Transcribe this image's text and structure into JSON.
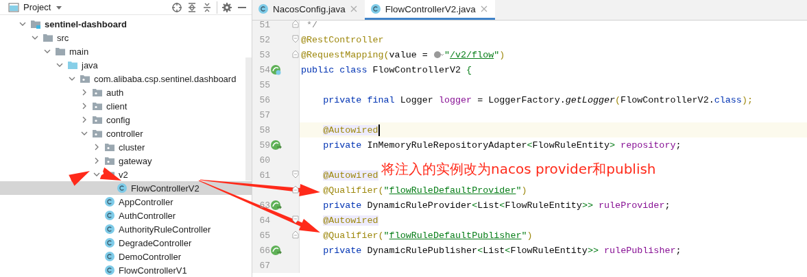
{
  "project_panel": {
    "title": "Project",
    "tree": [
      {
        "label": "sentinel-dashboard",
        "kind": "module",
        "expanded": true,
        "selected": false,
        "children": [
          {
            "label": "src",
            "kind": "folder",
            "expanded": true,
            "selected": false,
            "children": [
              {
                "label": "main",
                "kind": "folder",
                "expanded": true,
                "selected": false,
                "children": [
                  {
                    "label": "java",
                    "kind": "source",
                    "expanded": true,
                    "selected": false,
                    "children": [
                      {
                        "label": "com.alibaba.csp.sentinel.dashboard",
                        "kind": "package",
                        "expanded": true,
                        "selected": false,
                        "children": [
                          {
                            "label": "auth",
                            "kind": "package",
                            "expanded": false,
                            "selected": false
                          },
                          {
                            "label": "client",
                            "kind": "package",
                            "expanded": false,
                            "selected": false
                          },
                          {
                            "label": "config",
                            "kind": "package",
                            "expanded": false,
                            "selected": false
                          },
                          {
                            "label": "controller",
                            "kind": "package",
                            "expanded": true,
                            "selected": false,
                            "children": [
                              {
                                "label": "cluster",
                                "kind": "package",
                                "expanded": false,
                                "selected": false
                              },
                              {
                                "label": "gateway",
                                "kind": "package",
                                "expanded": false,
                                "selected": false
                              },
                              {
                                "label": "v2",
                                "kind": "package",
                                "expanded": true,
                                "selected": false,
                                "children": [
                                  {
                                    "label": "FlowControllerV2",
                                    "kind": "class",
                                    "selected": true
                                  }
                                ]
                              },
                              {
                                "label": "AppController",
                                "kind": "class",
                                "selected": false
                              },
                              {
                                "label": "AuthController",
                                "kind": "class",
                                "selected": false
                              },
                              {
                                "label": "AuthorityRuleController",
                                "kind": "class",
                                "selected": false
                              },
                              {
                                "label": "DegradeController",
                                "kind": "class",
                                "selected": false
                              },
                              {
                                "label": "DemoController",
                                "kind": "class",
                                "selected": false
                              },
                              {
                                "label": "FlowControllerV1",
                                "kind": "class",
                                "selected": false
                              }
                            ]
                          }
                        ]
                      }
                    ]
                  }
                ]
              }
            ]
          }
        ]
      }
    ]
  },
  "editor": {
    "tabs": [
      {
        "label": "NacosConfig.java",
        "selected": false
      },
      {
        "label": "FlowControllerV2.java",
        "selected": true
      }
    ],
    "lines": [
      {
        "number": "51",
        "fold": {
          "kind": "end"
        },
        "segments": [
          {
            "text": " */",
            "kind": "comment"
          }
        ]
      },
      {
        "number": "52",
        "fold": {
          "kind": "start"
        },
        "segments": [
          {
            "text": "@RestController",
            "kind": "ann"
          }
        ]
      },
      {
        "number": "53",
        "fold": {
          "kind": "end"
        },
        "segments": [
          {
            "text": "@RequestMapping(",
            "kind": "ann"
          },
          {
            "text": "value = ",
            "kind": "plain"
          },
          {
            "kind": "web-inlay"
          },
          {
            "text": "\"",
            "kind": "str"
          },
          {
            "text": "/v2/flow",
            "kind": "link"
          },
          {
            "text": "\"",
            "kind": "str"
          },
          {
            "text": ")",
            "kind": "ann"
          }
        ]
      },
      {
        "number": "54",
        "gutter": {
          "kind": "bean"
        },
        "segments": [
          {
            "text": "public class ",
            "kind": "kw"
          },
          {
            "text": "FlowControllerV2 ",
            "kind": "plain"
          },
          {
            "text": "{",
            "kind": "brace"
          }
        ]
      },
      {
        "number": "55"
      },
      {
        "number": "56",
        "segments": [
          {
            "text": "    private final ",
            "kind": "kw"
          },
          {
            "text": "Logger ",
            "kind": "plain"
          },
          {
            "text": "logger",
            "kind": "field"
          },
          {
            "text": " = LoggerFactory.",
            "kind": "plain"
          },
          {
            "text": "getLogger",
            "kind": "method"
          },
          {
            "text": "(",
            "kind": "ann"
          },
          {
            "text": "FlowControllerV2.",
            "kind": "plain"
          },
          {
            "text": "class",
            "kind": "kw"
          },
          {
            "text": ");",
            "kind": "ann"
          }
        ]
      },
      {
        "number": "57"
      },
      {
        "number": "58",
        "current": true,
        "caret": true,
        "segments": [
          {
            "text": "    @Autowired",
            "kind": "ann-hl"
          }
        ]
      },
      {
        "number": "59",
        "gutter": {
          "kind": "inject"
        },
        "segments": [
          {
            "text": "    private ",
            "kind": "kw"
          },
          {
            "text": "InMemoryRuleRepositoryAdapter",
            "kind": "plain"
          },
          {
            "text": "<",
            "kind": "angle"
          },
          {
            "text": "FlowRuleEntity",
            "kind": "plain"
          },
          {
            "text": ">",
            "kind": "angle"
          },
          {
            "text": " repository",
            "kind": "field"
          },
          {
            "text": ";",
            "kind": "plain"
          }
        ]
      },
      {
        "number": "60"
      },
      {
        "number": "61",
        "fold": {
          "kind": "start"
        },
        "segments": [
          {
            "text": "    @Autowired",
            "kind": "ann-hl"
          }
        ]
      },
      {
        "fold": {
          "kind": "end"
        },
        "segments": [
          {
            "text": "    @Qualifier(",
            "kind": "ann"
          },
          {
            "text": "\"",
            "kind": "str"
          },
          {
            "text": "flowRuleDefaultProvider",
            "kind": "link"
          },
          {
            "text": "\"",
            "kind": "str"
          },
          {
            "text": ")",
            "kind": "ann"
          }
        ]
      },
      {
        "number": "63",
        "gutter": {
          "kind": "inject"
        },
        "segments": [
          {
            "text": "    private ",
            "kind": "kw"
          },
          {
            "text": "DynamicRuleProvider",
            "kind": "plain"
          },
          {
            "text": "<",
            "kind": "angle"
          },
          {
            "text": "List",
            "kind": "plain"
          },
          {
            "text": "<",
            "kind": "angle"
          },
          {
            "text": "FlowRuleEntity",
            "kind": "plain"
          },
          {
            "text": ">>",
            "kind": "angle"
          },
          {
            "text": " ruleProvider",
            "kind": "field"
          },
          {
            "text": ";",
            "kind": "plain"
          }
        ]
      },
      {
        "number": "64",
        "fold": {
          "kind": "start"
        },
        "segments": [
          {
            "text": "    @Autowired",
            "kind": "ann-hl"
          }
        ]
      },
      {
        "number": "65",
        "fold": {
          "kind": "end"
        },
        "segments": [
          {
            "text": "    @Qualifier(",
            "kind": "ann"
          },
          {
            "text": "\"",
            "kind": "str"
          },
          {
            "text": "flowRuleDefaultPublisher",
            "kind": "link"
          },
          {
            "text": "\"",
            "kind": "str"
          },
          {
            "text": ")",
            "kind": "ann"
          }
        ]
      },
      {
        "number": "66",
        "gutter": {
          "kind": "inject"
        },
        "segments": [
          {
            "text": "    private ",
            "kind": "kw"
          },
          {
            "text": "DynamicRulePublisher",
            "kind": "plain"
          },
          {
            "text": "<",
            "kind": "angle"
          },
          {
            "text": "List",
            "kind": "plain"
          },
          {
            "text": "<",
            "kind": "angle"
          },
          {
            "text": "FlowRuleEntity",
            "kind": "plain"
          },
          {
            "text": ">>",
            "kind": "angle"
          },
          {
            "text": " rulePublisher",
            "kind": "field"
          },
          {
            "text": ";",
            "kind": "plain"
          }
        ]
      },
      {
        "number": "67"
      }
    ]
  },
  "annotation": {
    "text": "将注入的实例改为nacos provider和publish",
    "color": "#ff2a1a"
  }
}
